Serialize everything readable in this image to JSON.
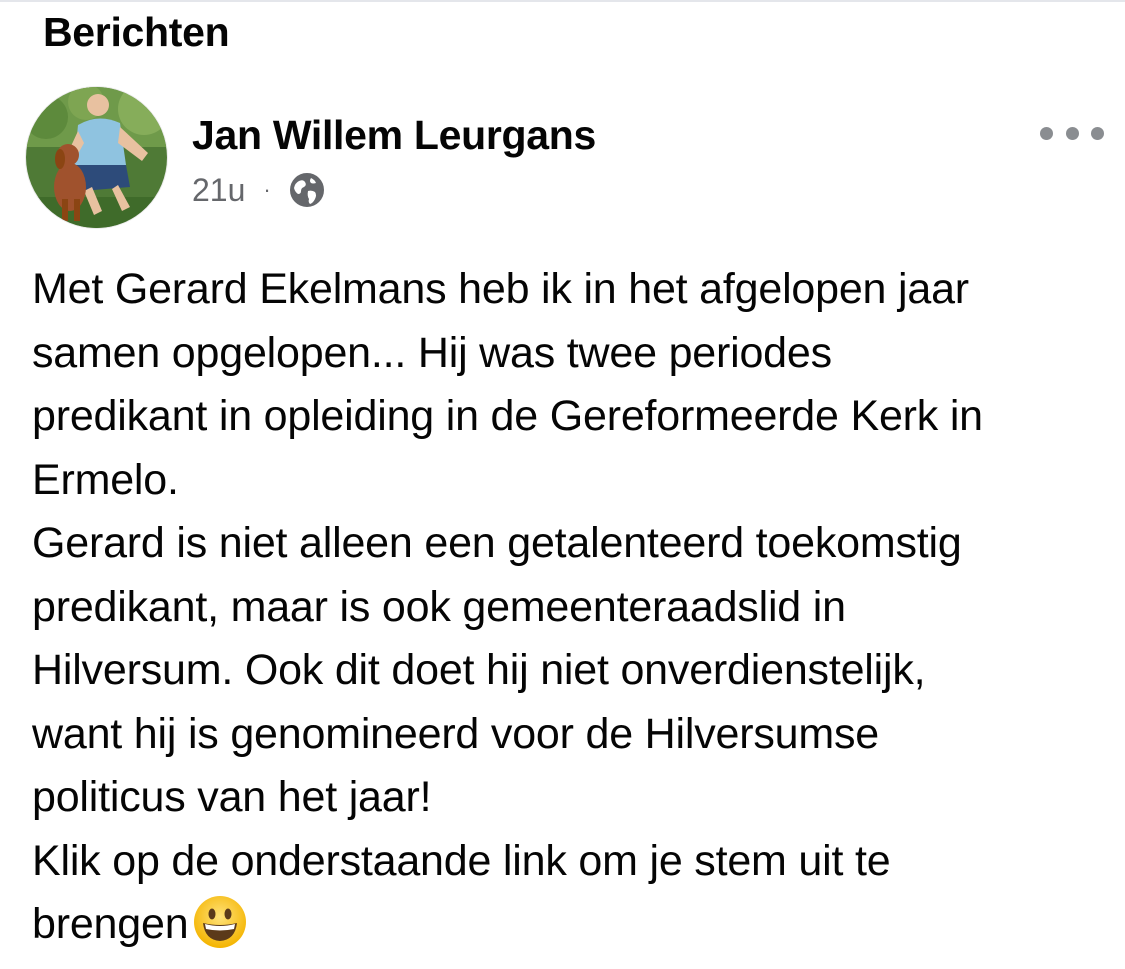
{
  "section": {
    "title": "Berichten"
  },
  "post": {
    "author": "Jan Willem Leurgans",
    "time": "21u",
    "separator": "·",
    "audience_icon": "globe-icon",
    "more_icon": "more-horizontal-icon",
    "body_lines": [
      "Met Gerard Ekelmans heb ik in het afgelopen jaar",
      "samen opgelopen... Hij was twee periodes",
      "predikant in opleiding in de Gereformeerde Kerk in",
      "Ermelo.",
      "Gerard is niet alleen een getalenteerd toekomstig",
      "predikant, maar is ook gemeenteraadslid in",
      "Hilversum. Ook dit doet hij niet onverdienstelijk,",
      "want hij is genomineerd voor de Hilversumse",
      "politicus van het jaar!",
      "Klik op de onderstaande link om je stem uit te",
      "brengen"
    ],
    "trailing_emoji": "grinning-face-emoji"
  },
  "colors": {
    "text_primary": "#050505",
    "text_secondary": "#65676b",
    "icon_gray": "#8a8d91",
    "divider": "#e4e6eb"
  }
}
